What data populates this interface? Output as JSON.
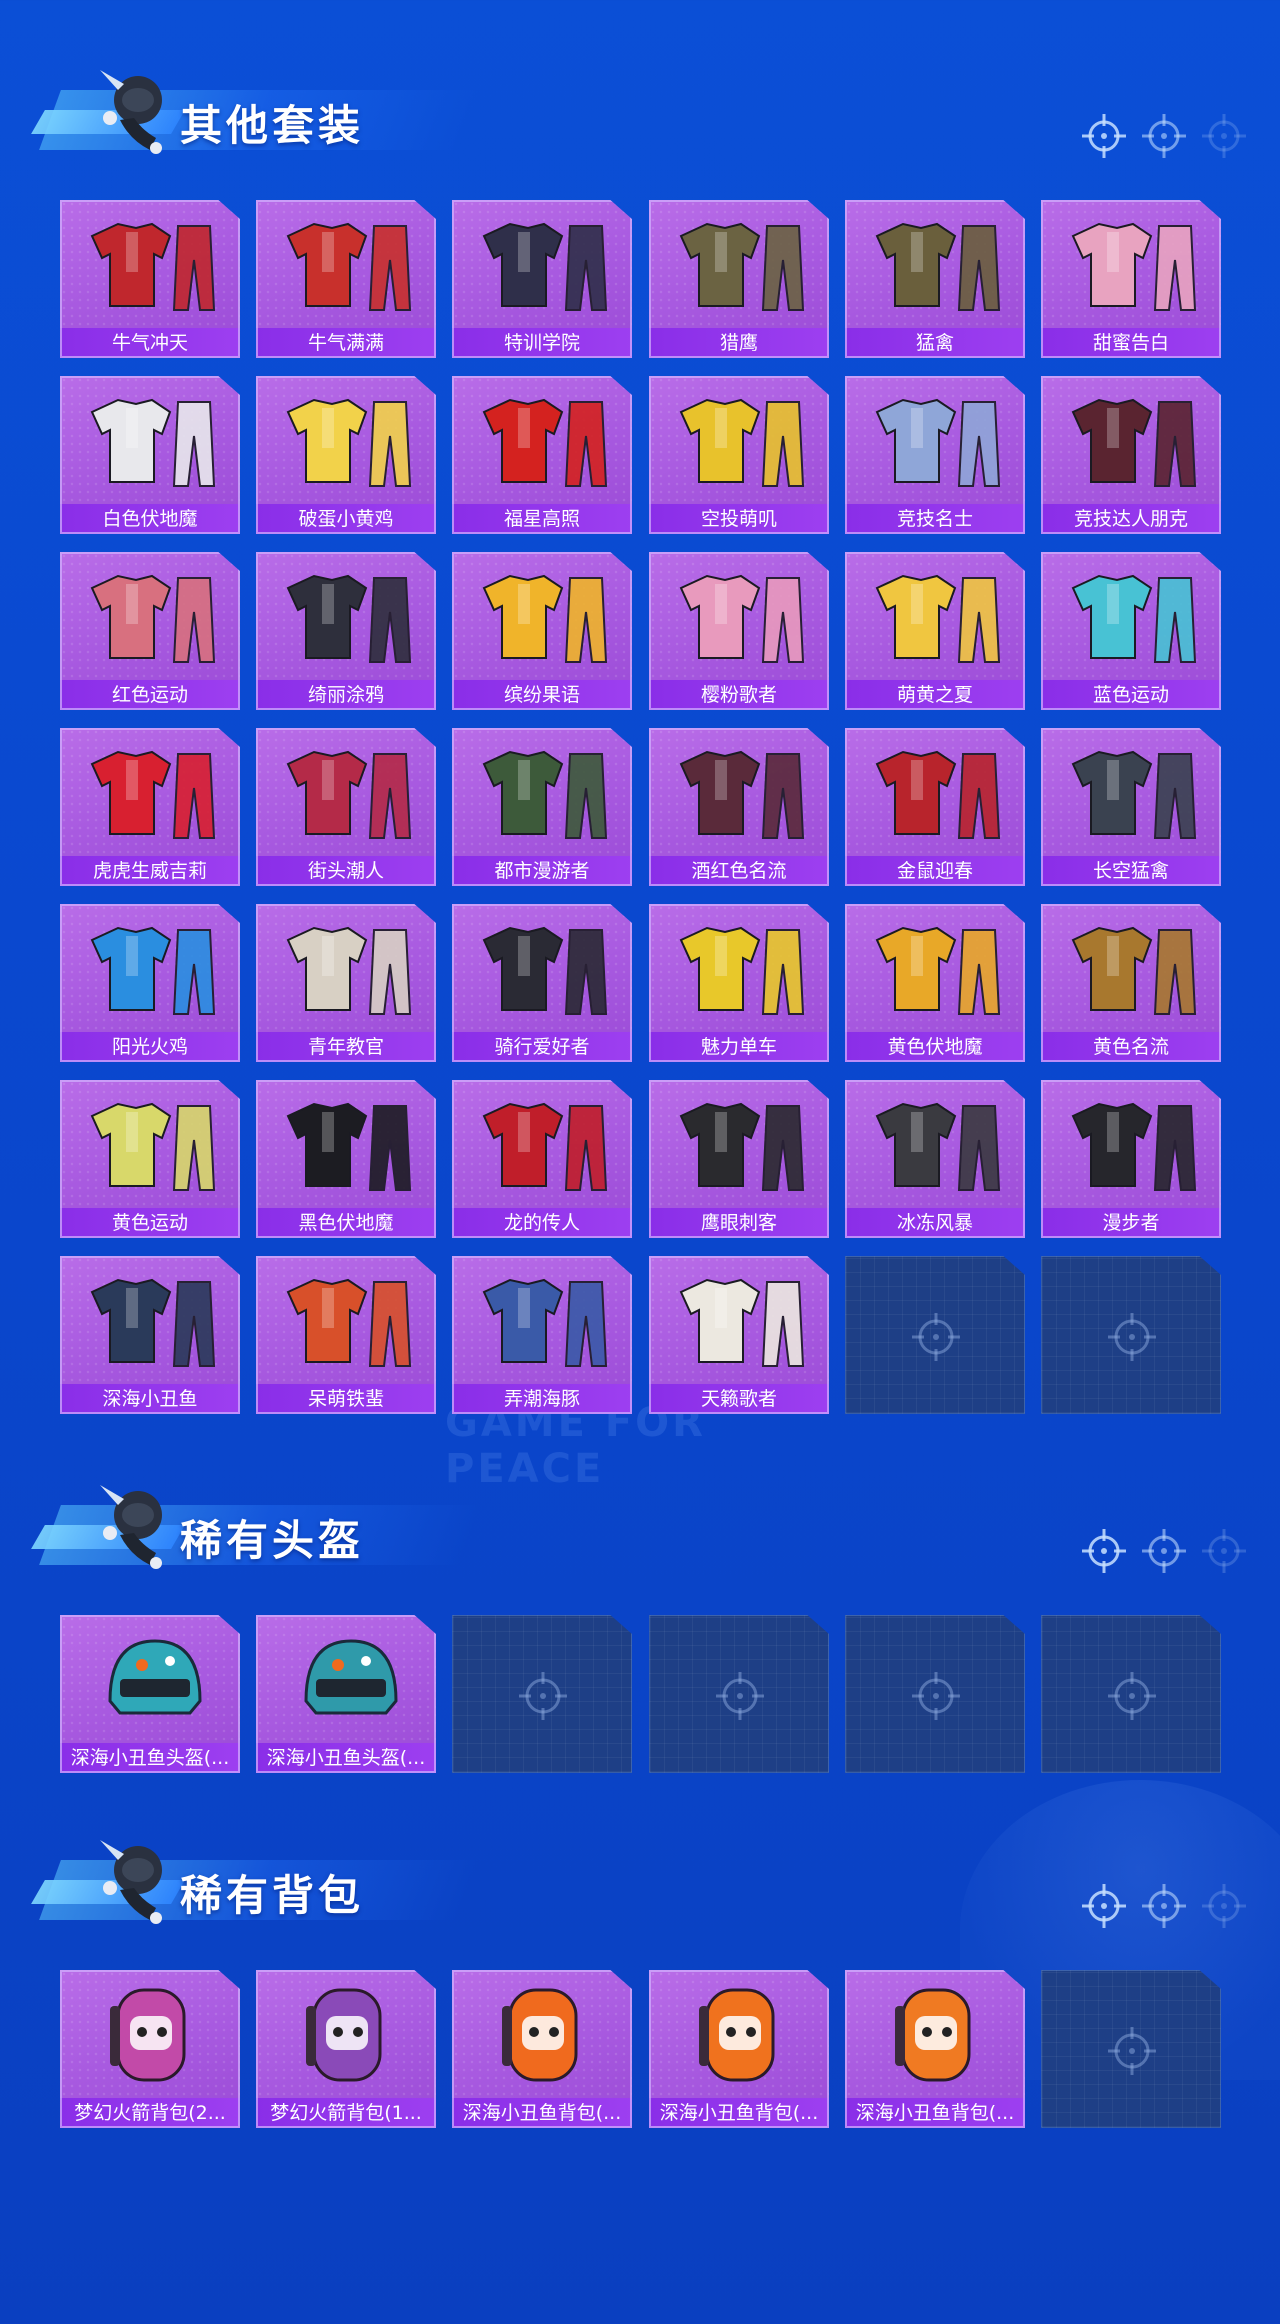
{
  "sections": [
    {
      "title": "其他套装",
      "items": [
        {
          "name": "牛气冲天",
          "kind": "outfit",
          "color": "#c0272d"
        },
        {
          "name": "牛气满满",
          "kind": "outfit",
          "color": "#c8302c"
        },
        {
          "name": "特训学院",
          "kind": "outfit",
          "color": "#2f2f4a"
        },
        {
          "name": "猎鹰",
          "kind": "outfit",
          "color": "#6b6342"
        },
        {
          "name": "猛禽",
          "kind": "outfit",
          "color": "#6a5f3c"
        },
        {
          "name": "甜蜜告白",
          "kind": "outfit",
          "color": "#e8a3c0"
        },
        {
          "name": "白色伏地魔",
          "kind": "outfit",
          "color": "#e8e8ec"
        },
        {
          "name": "破蛋小黄鸡",
          "kind": "outfit",
          "color": "#f2d24a"
        },
        {
          "name": "福星高照",
          "kind": "outfit",
          "color": "#d4221f"
        },
        {
          "name": "空投萌叽",
          "kind": "outfit",
          "color": "#e8c22c"
        },
        {
          "name": "竞技名士",
          "kind": "outfit",
          "color": "#8fa6d8"
        },
        {
          "name": "竞技达人朋克",
          "kind": "outfit",
          "color": "#5a2430"
        },
        {
          "name": "红色运动",
          "kind": "outfit",
          "color": "#d8707f"
        },
        {
          "name": "绮丽涂鸦",
          "kind": "outfit",
          "color": "#2e2f3c"
        },
        {
          "name": "缤纷果语",
          "kind": "outfit",
          "color": "#f0b42a"
        },
        {
          "name": "樱粉歌者",
          "kind": "outfit",
          "color": "#e89abd"
        },
        {
          "name": "萌黄之夏",
          "kind": "outfit",
          "color": "#f0c640"
        },
        {
          "name": "蓝色运动",
          "kind": "outfit",
          "color": "#48c2d4"
        },
        {
          "name": "虎虎生威吉莉",
          "kind": "outfit",
          "color": "#d82030"
        },
        {
          "name": "街头潮人",
          "kind": "outfit",
          "color": "#b42a48"
        },
        {
          "name": "都市漫游者",
          "kind": "outfit",
          "color": "#3d5a3a"
        },
        {
          "name": "酒红色名流",
          "kind": "outfit",
          "color": "#5a2a3a"
        },
        {
          "name": "金鼠迎春",
          "kind": "outfit",
          "color": "#b8242c"
        },
        {
          "name": "长空猛禽",
          "kind": "outfit",
          "color": "#3a4250"
        },
        {
          "name": "阳光火鸡",
          "kind": "outfit",
          "color": "#2a8ee0"
        },
        {
          "name": "青年教官",
          "kind": "outfit",
          "color": "#d8d0c4"
        },
        {
          "name": "骑行爱好者",
          "kind": "outfit",
          "color": "#2a2a34"
        },
        {
          "name": "魅力单车",
          "kind": "outfit",
          "color": "#e8c82a"
        },
        {
          "name": "黄色伏地魔",
          "kind": "outfit",
          "color": "#e8a828"
        },
        {
          "name": "黄色名流",
          "kind": "outfit",
          "color": "#a8782e"
        },
        {
          "name": "黄色运动",
          "kind": "outfit",
          "color": "#d8d86a"
        },
        {
          "name": "黑色伏地魔",
          "kind": "outfit",
          "color": "#1c1c22"
        },
        {
          "name": "龙的传人",
          "kind": "outfit",
          "color": "#c01e2a"
        },
        {
          "name": "鹰眼刺客",
          "kind": "outfit",
          "color": "#2a2a2e"
        },
        {
          "name": "冰冻风暴",
          "kind": "outfit",
          "color": "#3a3a40"
        },
        {
          "name": "漫步者",
          "kind": "outfit",
          "color": "#26262c"
        },
        {
          "name": "深海小丑鱼",
          "kind": "outfit",
          "color": "#2a3a5a"
        },
        {
          "name": "呆萌铁蜚",
          "kind": "outfit",
          "color": "#d8502a"
        },
        {
          "name": "弄潮海豚",
          "kind": "outfit",
          "color": "#3a5aa8"
        },
        {
          "name": "天籁歌者",
          "kind": "outfit",
          "color": "#ece8e0"
        },
        {
          "empty": true
        },
        {
          "empty": true
        }
      ]
    },
    {
      "title": "稀有头盔",
      "items": [
        {
          "name": "深海小丑鱼头盔(...",
          "kind": "helmet",
          "color": "#2fa8b8"
        },
        {
          "name": "深海小丑鱼头盔(...",
          "kind": "helmet",
          "color": "#2f9aaa"
        },
        {
          "empty": true
        },
        {
          "empty": true
        },
        {
          "empty": true
        },
        {
          "empty": true
        }
      ]
    },
    {
      "title": "稀有背包",
      "items": [
        {
          "name": "梦幻火箭背包(2...",
          "kind": "backpack",
          "color": "#c24aa8"
        },
        {
          "name": "梦幻火箭背包(1...",
          "kind": "backpack",
          "color": "#8a4ab8"
        },
        {
          "name": "深海小丑鱼背包(...",
          "kind": "backpack",
          "color": "#f06a1e"
        },
        {
          "name": "深海小丑鱼背包(...",
          "kind": "backpack",
          "color": "#f0721e"
        },
        {
          "name": "深海小丑鱼背包(...",
          "kind": "backpack",
          "color": "#f07a22"
        },
        {
          "empty": true
        }
      ]
    }
  ],
  "watermark": "GAME FOR PEACE",
  "colors": {
    "background": "#0b4fd6",
    "card": "#a85ae0",
    "label_bar": "#8a2ee8",
    "empty_slot": "#1e3f86"
  }
}
